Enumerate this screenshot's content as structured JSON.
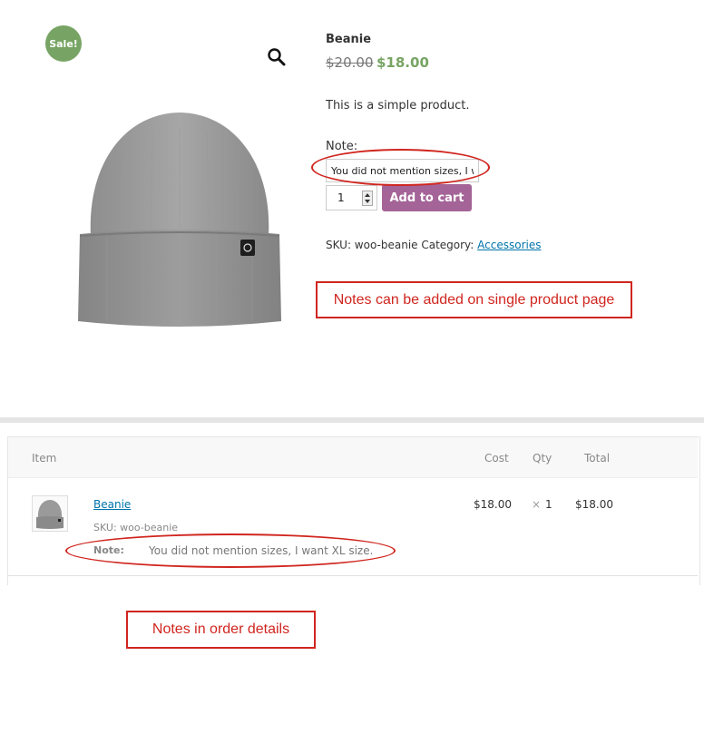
{
  "product": {
    "sale_badge": "Sale!",
    "title": "Beanie",
    "price_old": "$20.00",
    "price_new": "$18.00",
    "description": "This is a simple product.",
    "note_label": "Note:",
    "note_value": "You did not mention sizes, I want XL size.",
    "quantity": "1",
    "add_to_cart_label": "Add to cart",
    "sku_text": "SKU: woo-beanie Category:",
    "category_link": "Accessories",
    "icons": {
      "zoom": "search-icon"
    }
  },
  "annotations": {
    "single_product": "Notes can be added on single product page",
    "order_details": "Notes in order details"
  },
  "order": {
    "columns": {
      "item": "Item",
      "cost": "Cost",
      "qty": "Qty",
      "total": "Total"
    },
    "row": {
      "name": "Beanie",
      "sku": "SKU: woo-beanie",
      "note_key": "Note:",
      "note_value": "You did not mention sizes, I want XL size.",
      "cost": "$18.00",
      "times": "×",
      "qty": "1",
      "total": "$18.00"
    }
  },
  "colors": {
    "sale_badge": "#77a464",
    "sale_price": "#77a464",
    "add_to_cart": "#a46497",
    "annotation": "#d0261f",
    "link": "#0073aa"
  }
}
